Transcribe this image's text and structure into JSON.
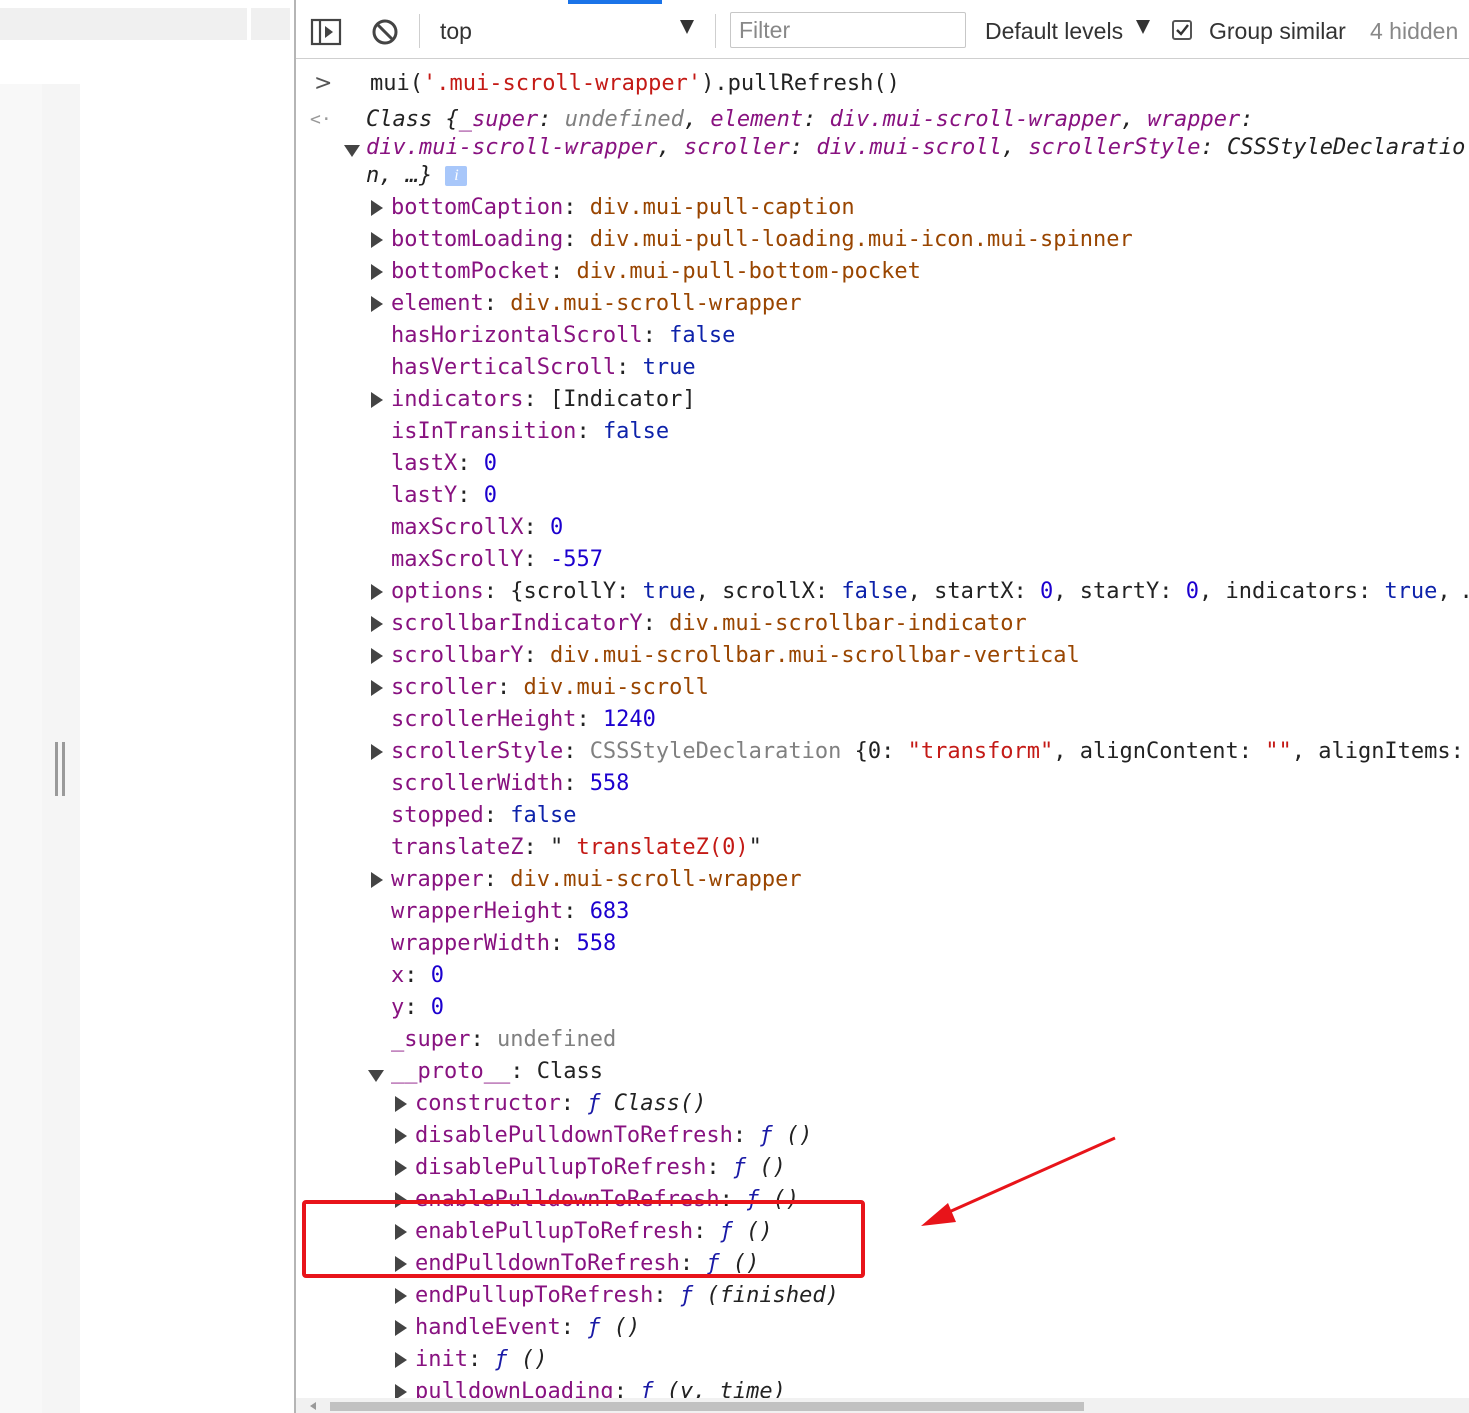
{
  "toolbar": {
    "sidebar_toggle_icon": "sidebar-toggle-icon",
    "clear_icon": "clear-console-icon",
    "context": "top",
    "filter_placeholder": "Filter",
    "levels": "Default levels",
    "group_similar": "Group similar",
    "group_similar_checked": true,
    "hidden_count": "4 hidden"
  },
  "colors": {
    "accent": "#1a73e8",
    "property_name": "#881280",
    "string": "#c41a16",
    "number": "#1c00cf",
    "boolean": "#0d22aa",
    "element": "#994500",
    "highlight_box": "#e8141a"
  },
  "console": {
    "command": {
      "prefix": ">",
      "fn": "mui(",
      "arg": "'.mui-scroll-wrapper'",
      "rest": ").pullRefresh()"
    },
    "result": {
      "prefix": "<·",
      "line1": {
        "a": "Class {",
        "b": "_super",
        "c": ": ",
        "d": "undefined",
        "e": ", ",
        "f": "element",
        "g": ": ",
        "h": "div.mui-scroll-wrapper",
        "i": ", ",
        "j": "wrapper",
        "k": ":"
      },
      "line2": {
        "a": "div.mui-scroll-wrapper",
        "b": ", ",
        "c": "scroller",
        "d": ": ",
        "e": "div.mui-scroll",
        "f": ", ",
        "g": "scrollerStyle",
        "h": ": CSSStyleDeclaratio"
      },
      "line3": {
        "a": "n, …}",
        "badge": "i"
      }
    },
    "props": [
      {
        "name": "bottomCaption",
        "value": "div.mui-pull-caption",
        "type": "element",
        "expand": true
      },
      {
        "name": "bottomLoading",
        "value": "div.mui-pull-loading.mui-icon.mui-spinner",
        "type": "element",
        "expand": true
      },
      {
        "name": "bottomPocket",
        "value": "div.mui-pull-bottom-pocket",
        "type": "element",
        "expand": true
      },
      {
        "name": "element",
        "value": "div.mui-scroll-wrapper",
        "type": "element",
        "expand": true
      },
      {
        "name": "hasHorizontalScroll",
        "value": "false",
        "type": "bool",
        "expand": false
      },
      {
        "name": "hasVerticalScroll",
        "value": "true",
        "type": "bool",
        "expand": false
      },
      {
        "name": "indicators",
        "value": "[Indicator]",
        "type": "plain",
        "expand": true
      },
      {
        "name": "isInTransition",
        "value": "false",
        "type": "bool",
        "expand": false
      },
      {
        "name": "lastX",
        "value": "0",
        "type": "num",
        "expand": false
      },
      {
        "name": "lastY",
        "value": "0",
        "type": "num",
        "expand": false
      },
      {
        "name": "maxScrollX",
        "value": "0",
        "type": "num",
        "expand": false
      },
      {
        "name": "maxScrollY",
        "value": "-557",
        "type": "num",
        "expand": false
      }
    ],
    "options_line": {
      "name": "options",
      "p1": "{scrollY: ",
      "v1": "true",
      "p2": ", scrollX: ",
      "v2": "false",
      "p3": ", startX: ",
      "v3": "0",
      "p4": ", startY: ",
      "v4": "0",
      "p5": ", indicators: ",
      "v5": "true",
      "p6": ", …"
    },
    "props2": [
      {
        "name": "scrollbarIndicatorY",
        "value": "div.mui-scrollbar-indicator",
        "type": "element",
        "expand": true
      },
      {
        "name": "scrollbarY",
        "value": "div.mui-scrollbar.mui-scrollbar-vertical",
        "type": "element",
        "expand": true
      },
      {
        "name": "scroller",
        "value": "div.mui-scroll",
        "type": "element",
        "expand": true
      },
      {
        "name": "scrollerHeight",
        "value": "1240",
        "type": "num",
        "expand": false
      }
    ],
    "style_line": {
      "name": "scrollerStyle",
      "cls": "CSSStyleDeclaration",
      "p1": " {0: ",
      "s1": "\"transform\"",
      "p2": ", alignContent: ",
      "s2": "\"\"",
      "p3": ", alignItems:"
    },
    "props3": [
      {
        "name": "scrollerWidth",
        "value": "558",
        "type": "num",
        "expand": false
      },
      {
        "name": "stopped",
        "value": "false",
        "type": "bool",
        "expand": false
      }
    ],
    "translate_line": {
      "name": "translateZ",
      "q1": "\" ",
      "v": "translateZ(0)",
      "q2": "\""
    },
    "props4": [
      {
        "name": "wrapper",
        "value": "div.mui-scroll-wrapper",
        "type": "element",
        "expand": true
      },
      {
        "name": "wrapperHeight",
        "value": "683",
        "type": "num",
        "expand": false
      },
      {
        "name": "wrapperWidth",
        "value": "558",
        "type": "num",
        "expand": false
      },
      {
        "name": "x",
        "value": "0",
        "type": "num",
        "expand": false
      },
      {
        "name": "y",
        "value": "0",
        "type": "num",
        "expand": false
      },
      {
        "name": "_super",
        "value": "undefined",
        "type": "gray",
        "expand": false
      }
    ],
    "proto": {
      "name": "__proto__",
      "value": "Class"
    },
    "methods": [
      {
        "name": "constructor",
        "sig": "Class()"
      },
      {
        "name": "disablePulldownToRefresh",
        "sig": "()"
      },
      {
        "name": "disablePullupToRefresh",
        "sig": "()"
      },
      {
        "name": "enablePulldownToRefresh",
        "sig": "()"
      },
      {
        "name": "enablePullupToRefresh",
        "sig": "()"
      },
      {
        "name": "endPulldownToRefresh",
        "sig": "()"
      },
      {
        "name": "endPullupToRefresh",
        "sig": "(finished)"
      },
      {
        "name": "handleEvent",
        "sig": "()"
      },
      {
        "name": "init",
        "sig": "()"
      },
      {
        "name": "pulldownLoading",
        "sig": "(y, time)"
      }
    ],
    "fn_glyph": "ƒ"
  }
}
